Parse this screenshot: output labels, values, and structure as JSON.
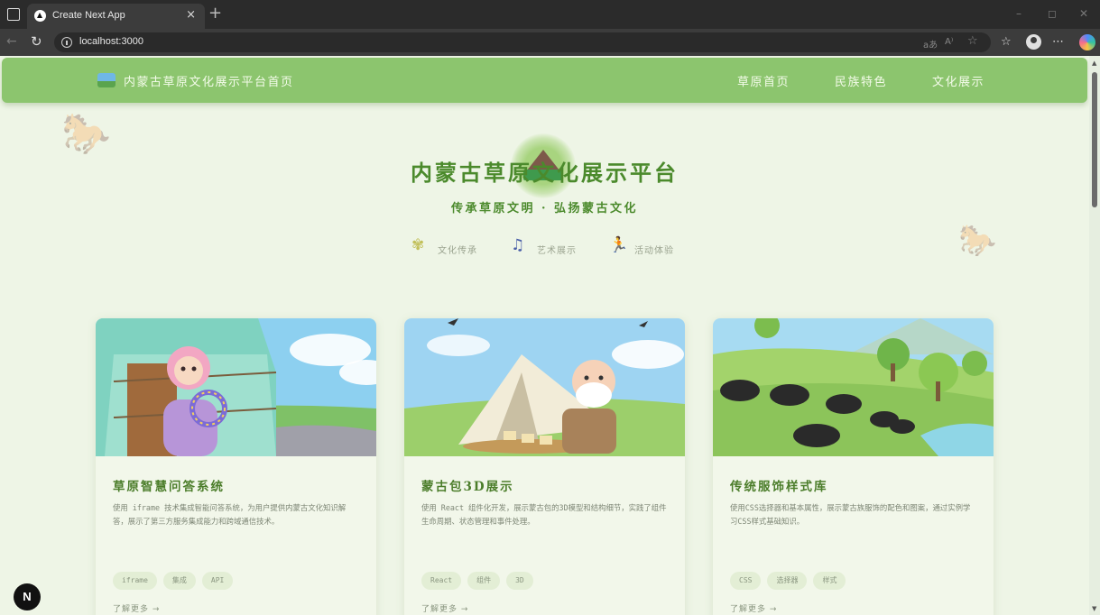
{
  "browser": {
    "tab_title": "Create Next App",
    "tab_close": "×",
    "new_tab": "+",
    "url": "localhost:3000",
    "min": "–",
    "max": "◻",
    "close": "✕"
  },
  "navbar": {
    "brand": "内蒙古草原文化展示平台首页",
    "links": [
      "草原首页",
      "民族特色",
      "文化展示"
    ]
  },
  "hero": {
    "title": "内蒙古草原文化展示平台",
    "subtitle": "传承草原文明 · 弘扬蒙古文化",
    "features": [
      {
        "icon": "wheat-icon",
        "label": "文化传承"
      },
      {
        "icon": "music-note-icon",
        "label": "艺术展示"
      },
      {
        "icon": "running-icon",
        "label": "活动体验"
      }
    ]
  },
  "cards": [
    {
      "title": "草原智慧问答系统",
      "description": "使用 iframe 技术集成智能问答系统，为用户提供内蒙古文化知识解答，展示了第三方服务集成能力和跨域通信技术。",
      "tags": [
        "iframe",
        "集成",
        "API"
      ],
      "link": "了解更多 →"
    },
    {
      "title": "蒙古包3D展示",
      "description": "使用 React 组件化开发，展示蒙古包的3D模型和结构细节，实践了组件生命周期、状态管理和事件处理。",
      "tags": [
        "React",
        "组件",
        "3D"
      ],
      "link": "了解更多 →"
    },
    {
      "title": "传统服饰样式库",
      "description": "使用CSS选择器和基本属性，展示蒙古族服饰的配色和图案，通过实例学习CSS样式基础知识。",
      "tags": [
        "CSS",
        "选择器",
        "样式"
      ],
      "link": "了解更多 →"
    }
  ],
  "dev_indicator": "N",
  "colors": {
    "navbar": "#8cc56e",
    "page_bg": "#eef5e6",
    "title_green": "#4b8a2c"
  }
}
